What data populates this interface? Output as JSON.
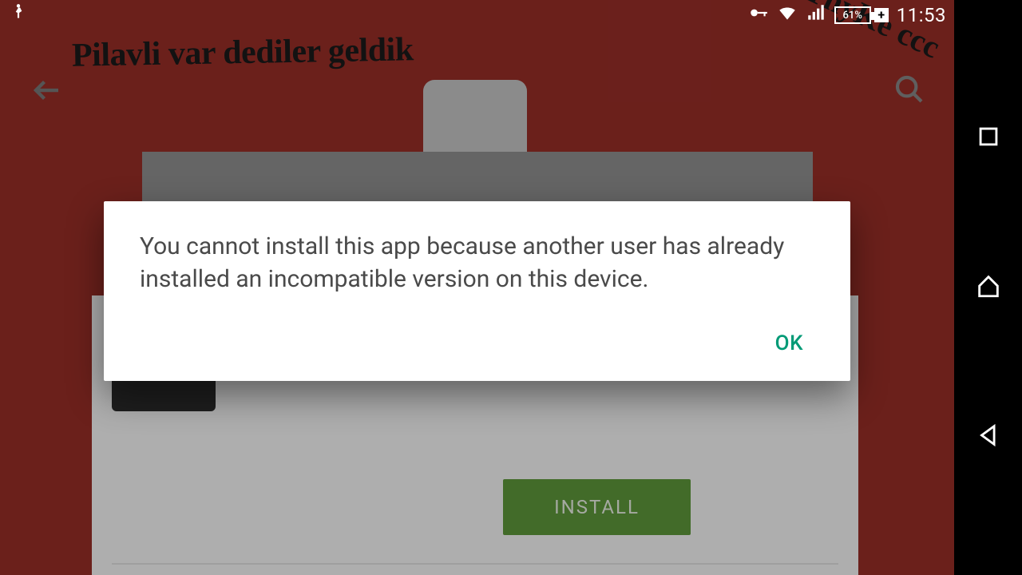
{
  "status": {
    "battery_text": "61%",
    "clock": "11:53"
  },
  "graffiti": {
    "line1": "Pilavli var dediler geldik",
    "line2": "ccc ThyKe ccc"
  },
  "store": {
    "install_label": "INSTALL"
  },
  "dialog": {
    "message": "You cannot install this app because another user has already installed an incompatible version on this device.",
    "ok_label": "OK"
  },
  "colors": {
    "header_bg": "#9a2e28",
    "install_btn": "#5f9a3c",
    "ok_text": "#009a76"
  }
}
